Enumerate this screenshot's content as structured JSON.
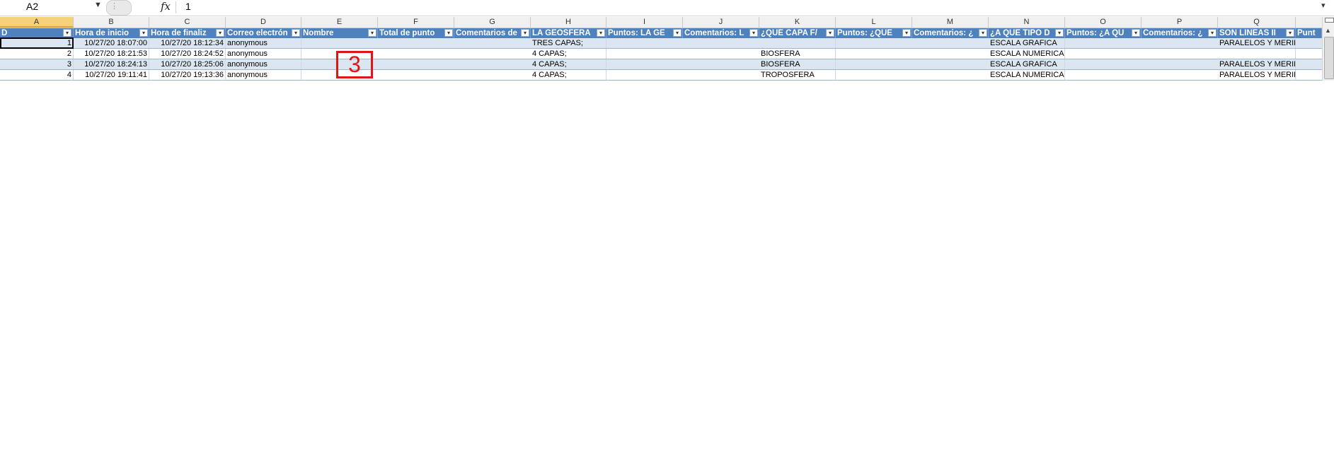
{
  "formula_bar": {
    "name_box": "A2",
    "fx_label": "fx",
    "value": "1"
  },
  "columns": [
    "A",
    "B",
    "C",
    "D",
    "E",
    "F",
    "G",
    "H",
    "I",
    "J",
    "K",
    "L",
    "M",
    "N",
    "O",
    "P",
    "Q"
  ],
  "headers": [
    "D",
    "Hora de inicio",
    "Hora de finaliz",
    "Correo electrón",
    "Nombre",
    "Total de punto",
    "Comentarios de",
    "LA GEOSFERA",
    "Puntos: LA GE",
    "Comentarios: L",
    "¿QUE CAPA F/",
    "Puntos: ¿QUE",
    "Comentarios: ¿",
    "¿A QUE TIPO D",
    "Puntos: ¿A QU",
    "Comentarios: ¿",
    "SON LINEAS II",
    "Punt"
  ],
  "rows": [
    {
      "id": "1",
      "start": "10/27/20 18:07:00",
      "end": "10/27/20 18:12:34",
      "email": "anonymous",
      "h": "TRES CAPAS;",
      "k": "",
      "n": "ESCALA GRAFICA",
      "q": "PARALELOS Y MERIDIAN"
    },
    {
      "id": "2",
      "start": "10/27/20 18:21:53",
      "end": "10/27/20 18:24:52",
      "email": "anonymous",
      "h": "4 CAPAS;",
      "k": "BIOSFERA",
      "n": "ESCALA NUMERICA",
      "q": ""
    },
    {
      "id": "3",
      "start": "10/27/20 18:24:13",
      "end": "10/27/20 18:25:06",
      "email": "anonymous",
      "h": "4 CAPAS;",
      "k": "BIOSFERA",
      "n": "ESCALA GRAFICA",
      "q": "PARALELOS Y MERIDIAN"
    },
    {
      "id": "4",
      "start": "10/27/20 19:11:41",
      "end": "10/27/20 19:13:36",
      "email": "anonymous",
      "h": "4 CAPAS;",
      "k": "TROPOSFERA",
      "n": "ESCALA NUMERICA",
      "q": "PARALELOS Y MERIDIAN"
    }
  ],
  "annotation": {
    "label": "3",
    "color": "#e01515"
  },
  "colors": {
    "header_bg": "#4f81bd",
    "band_bg": "#dce6f1",
    "selected_col": "#f6d17a"
  }
}
